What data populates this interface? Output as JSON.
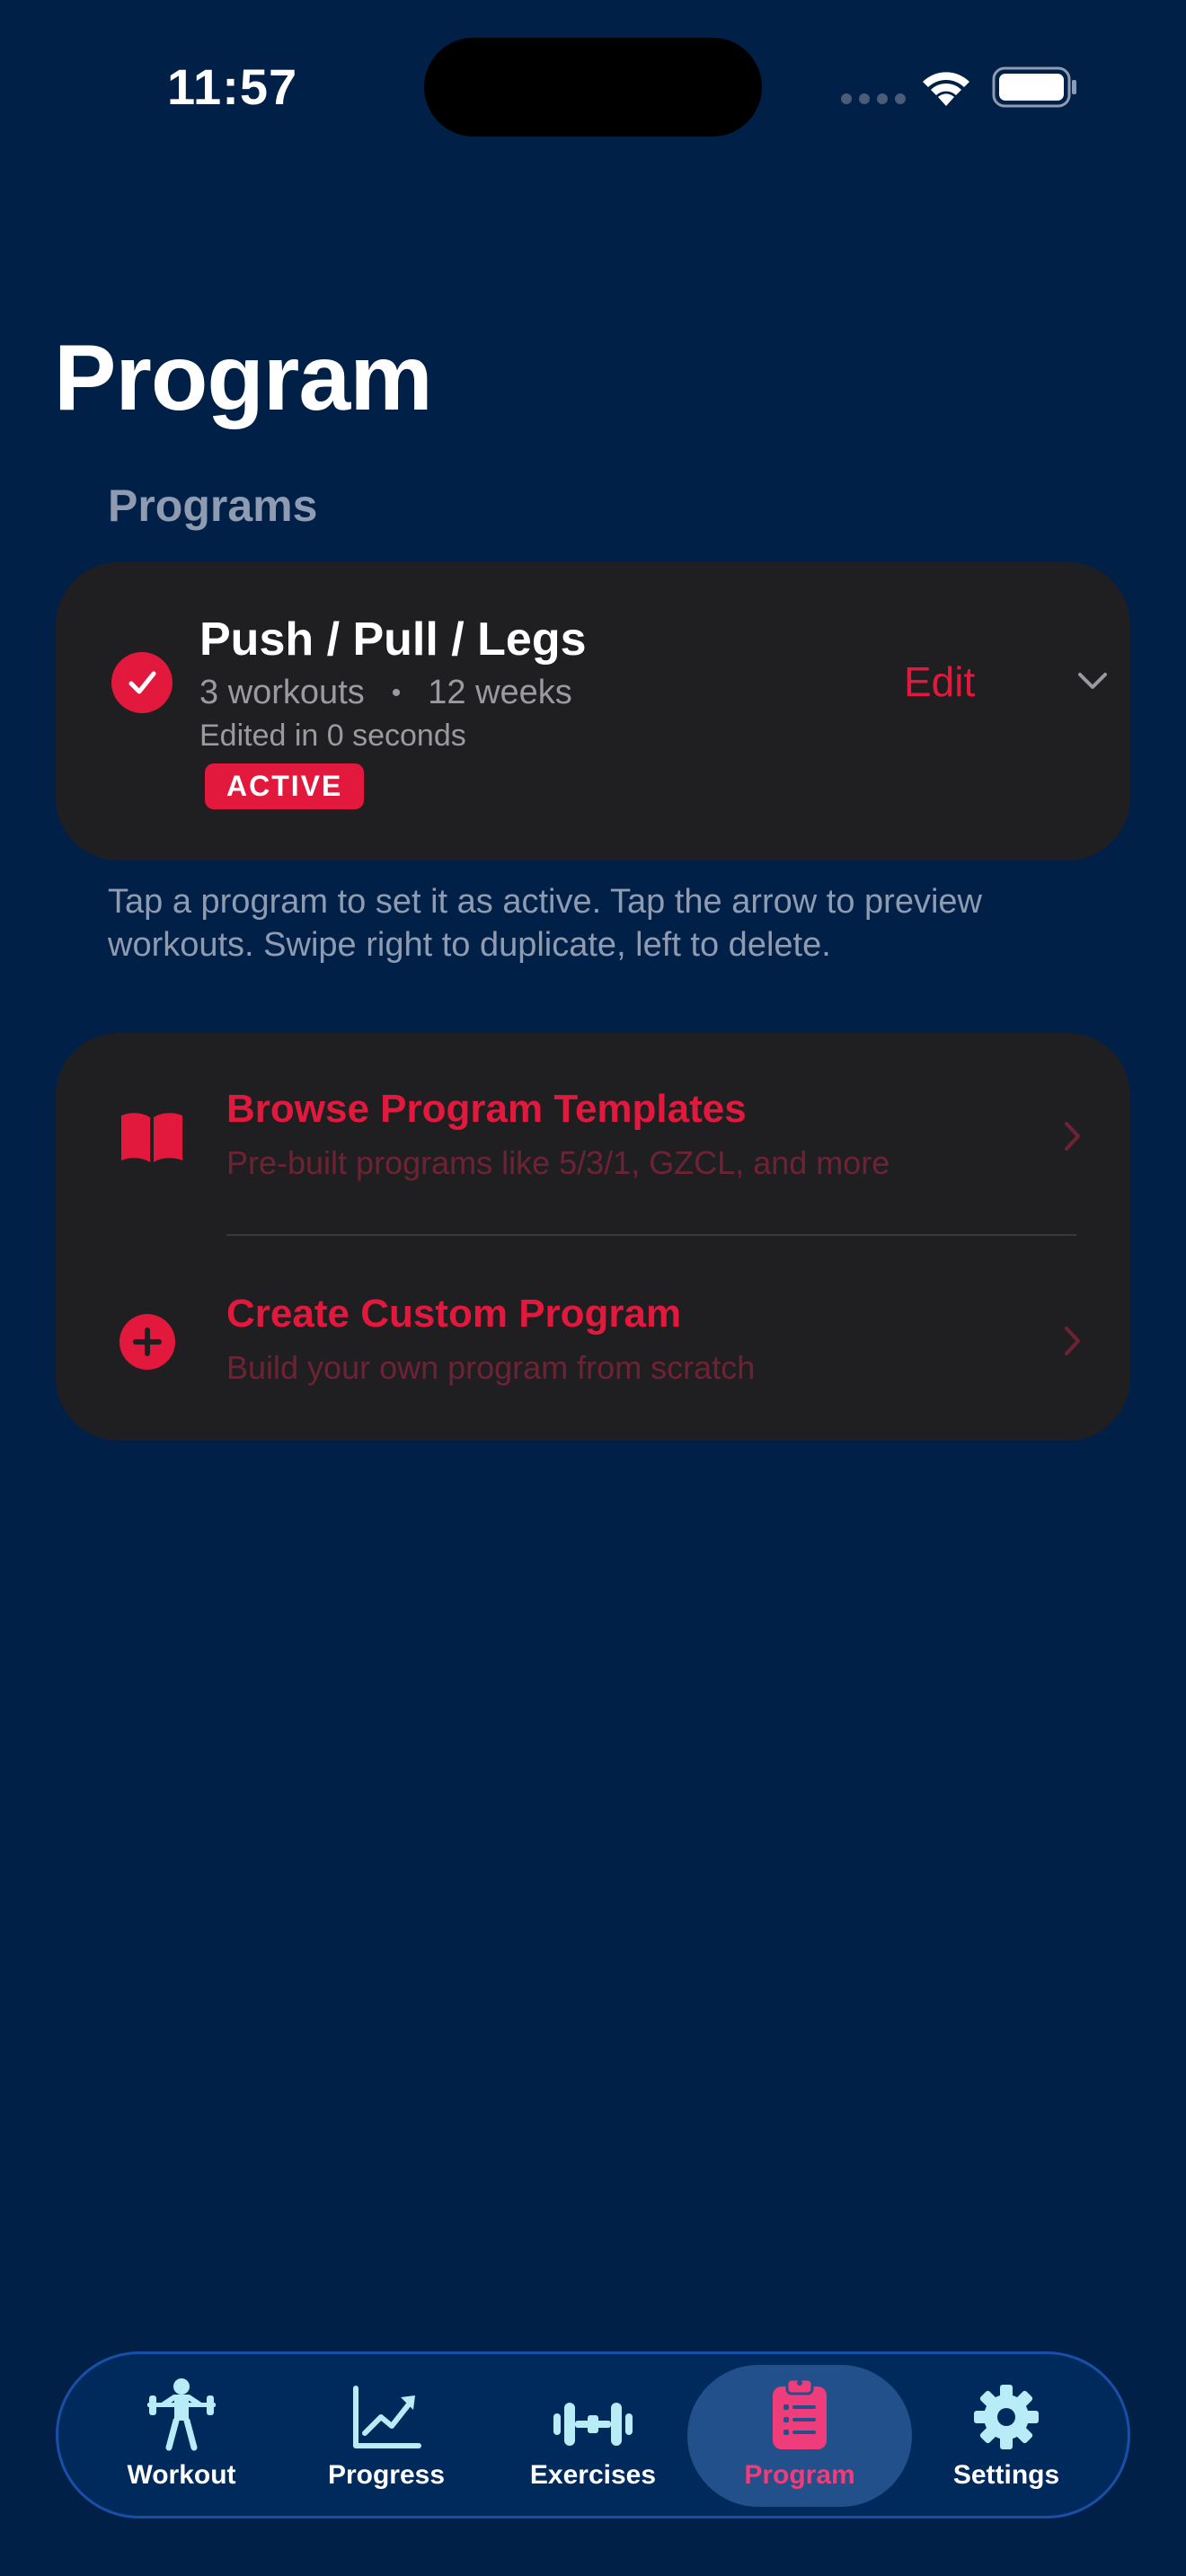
{
  "status_bar": {
    "time": "11:57"
  },
  "page": {
    "title": "Program"
  },
  "programs_section": {
    "header": "Programs",
    "program": {
      "name": "Push / Pull / Legs",
      "workouts": "3 workouts",
      "separator": "•",
      "weeks": "12 weeks",
      "edited": "Edited in 0 seconds",
      "badge": "ACTIVE",
      "edit_label": "Edit"
    },
    "hint": "Tap a program to set it as active. Tap the arrow to preview workouts. Swipe right to duplicate, left to delete."
  },
  "actions": [
    {
      "title": "Browse Program Templates",
      "subtitle": "Pre-built programs like 5/3/1, GZCL, and more",
      "icon": "book-icon"
    },
    {
      "title": "Create Custom Program",
      "subtitle": "Build your own program from scratch",
      "icon": "plus-circle-icon"
    }
  ],
  "tab_bar": {
    "tabs": [
      {
        "label": "Workout",
        "icon": "weightlifter-icon"
      },
      {
        "label": "Progress",
        "icon": "chart-line-icon"
      },
      {
        "label": "Exercises",
        "icon": "dumbbell-icon"
      },
      {
        "label": "Program",
        "icon": "clipboard-icon"
      },
      {
        "label": "Settings",
        "icon": "gear-icon"
      }
    ],
    "active": "Program"
  },
  "colors": {
    "background": "#002047",
    "accent": "#e2193c",
    "card": "#1f1f21",
    "active_tab_label": "#ee3d7a"
  }
}
